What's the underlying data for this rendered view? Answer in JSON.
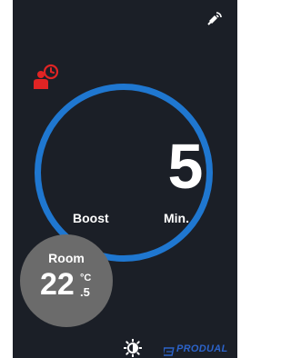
{
  "colors": {
    "background": "#1b1f27",
    "ring": "#1f77d0",
    "accent_red": "#e02424",
    "room_bubble": "#6b6b6b",
    "brand": "#2c63c9"
  },
  "icons": {
    "top_right": "satellite-signal-icon",
    "status": "user-clock-icon",
    "bottom": "sun-icon",
    "brand_logo": "brand-logo-icon"
  },
  "boost": {
    "mode_label": "Boost",
    "value": "5",
    "unit": "Min."
  },
  "room": {
    "label": "Room",
    "temperature_int": "22",
    "temperature_unit": "°C",
    "temperature_dec": ".5"
  },
  "brand": {
    "name": "PRODUAL"
  }
}
